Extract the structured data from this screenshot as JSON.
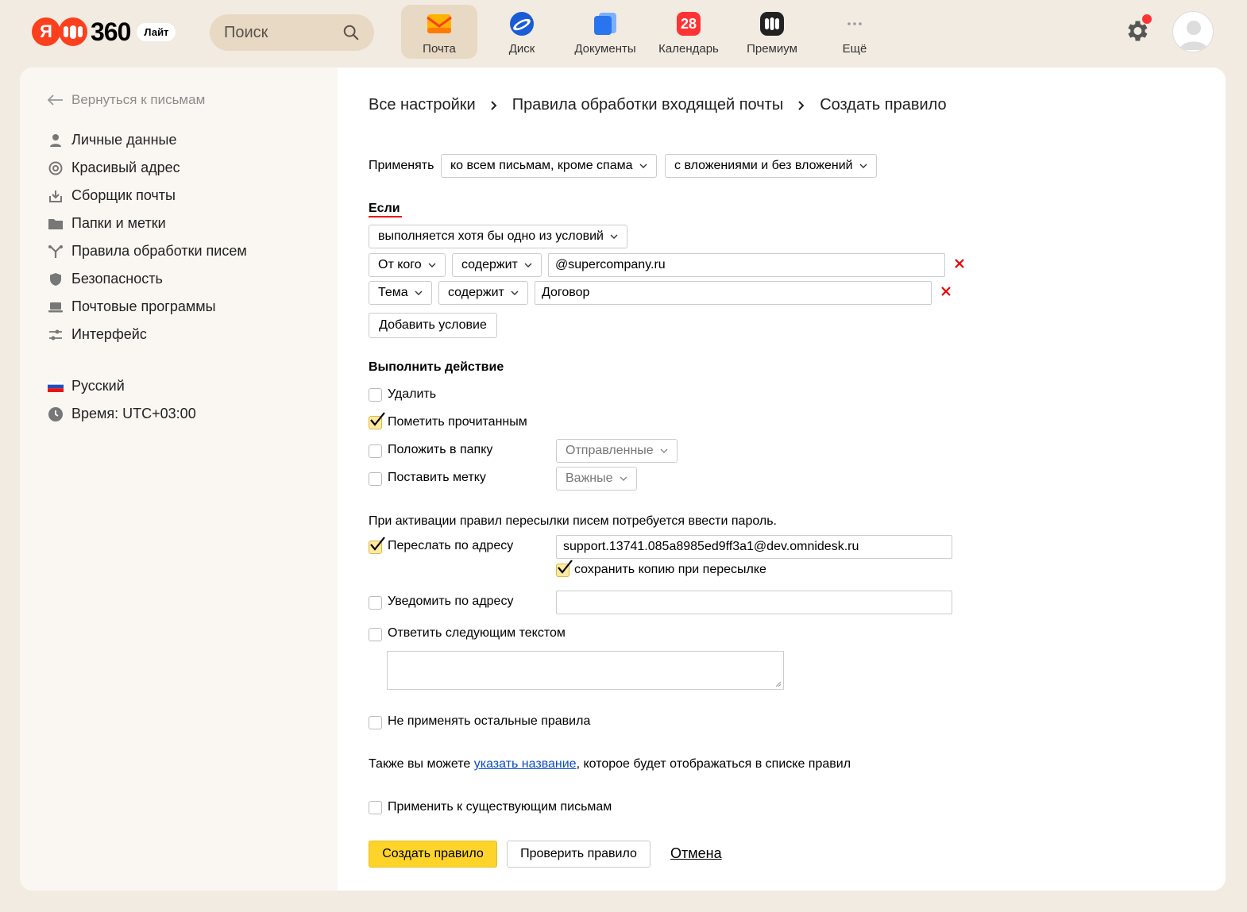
{
  "header": {
    "logo_ya": "Я",
    "logo_360": "360",
    "logo_badge": "Лайт",
    "search_placeholder": "Поиск",
    "services": [
      {
        "label": "Почта",
        "icon": "mail-icon"
      },
      {
        "label": "Диск",
        "icon": "disk-icon"
      },
      {
        "label": "Документы",
        "icon": "documents-icon"
      },
      {
        "label": "Календарь",
        "icon": "calendar-icon",
        "badge": "28"
      },
      {
        "label": "Премиум",
        "icon": "premium-icon"
      },
      {
        "label": "Ещё",
        "icon": "more-icon"
      }
    ],
    "colors": {
      "accent": "#fc3f1d",
      "notification": "#ff3333",
      "active_bg": "#e8d9c5"
    }
  },
  "sidebar": {
    "back": "Вернуться к письмам",
    "items": [
      {
        "label": "Личные данные",
        "icon": "person-icon"
      },
      {
        "label": "Красивый адрес",
        "icon": "at-icon"
      },
      {
        "label": "Сборщик почты",
        "icon": "inbox-download-icon"
      },
      {
        "label": "Папки и метки",
        "icon": "folder-icon"
      },
      {
        "label": "Правила обработки писем",
        "icon": "branch-icon"
      },
      {
        "label": "Безопасность",
        "icon": "shield-icon"
      },
      {
        "label": "Почтовые программы",
        "icon": "laptop-icon"
      },
      {
        "label": "Интерфейс",
        "icon": "sliders-icon"
      }
    ],
    "language": "Русский",
    "time": "Время: UTC+03:00"
  },
  "breadcrumbs": [
    "Все настройки",
    "Правила обработки входящей почты",
    "Создать правило"
  ],
  "form": {
    "apply_label": "Применять",
    "apply_scope": "ко всем письмам, кроме спама",
    "apply_attachments": "с вложениями и без вложений",
    "if_heading": "Если",
    "condition_mode": "выполняется хотя бы одно из условий",
    "conditions": [
      {
        "field": "От кого",
        "op": "содержит",
        "value": "@supercompany.ru"
      },
      {
        "field": "Тема",
        "op": "содержит",
        "value": "Договор"
      }
    ],
    "add_condition": "Добавить условие",
    "action_heading": "Выполнить действие",
    "actions": {
      "delete": {
        "label": "Удалить",
        "checked": false
      },
      "mark_read": {
        "label": "Пометить прочитанным",
        "checked": true
      },
      "move_folder": {
        "label": "Положить в папку",
        "checked": false,
        "select": "Отправленные"
      },
      "set_label": {
        "label": "Поставить метку",
        "checked": false,
        "select": "Важные"
      }
    },
    "forward_note": "При активации правил пересылки писем потребуется ввести пароль.",
    "forward": {
      "label": "Переслать по адресу",
      "checked": true,
      "value": "support.13741.085a8985ed9ff3a1@dev.omnidesk.ru"
    },
    "keep_copy": {
      "label": "сохранить копию при пересылке",
      "checked": true
    },
    "notify": {
      "label": "Уведомить по адресу",
      "checked": false,
      "value": ""
    },
    "reply": {
      "label": "Ответить следующим текстом",
      "checked": false,
      "value": ""
    },
    "stop_rules": {
      "label": "Не применять остальные правила",
      "checked": false
    },
    "name_hint_before": "Также вы можете ",
    "name_hint_link": "указать название",
    "name_hint_after": ", которое будет отображаться в списке правил",
    "apply_existing": {
      "label": "Применить к существующим письмам",
      "checked": false
    },
    "submit": "Создать правило",
    "test": "Проверить правило",
    "cancel": "Отмена"
  }
}
